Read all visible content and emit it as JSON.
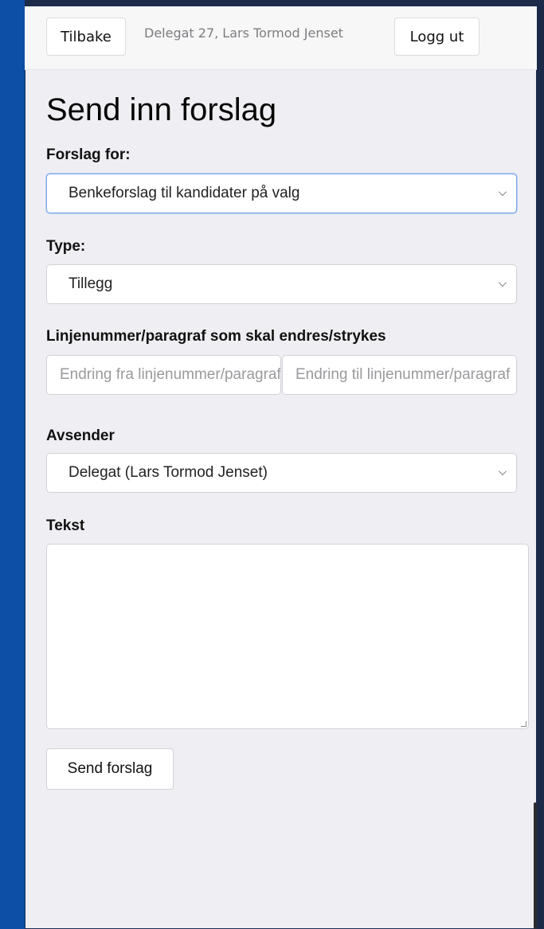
{
  "navbar": {
    "back_label": "Tilbake",
    "user_label": "Delegat 27, Lars Tormod Jenset",
    "logout_label": "Logg ut"
  },
  "page": {
    "title": "Send inn forslag"
  },
  "form": {
    "proposal_for": {
      "label": "Forslag for:",
      "selected": "Benkeforslag til kandidater på valg"
    },
    "type": {
      "label": "Type:",
      "selected": "Tillegg"
    },
    "line_numbers": {
      "label": "Linjenummer/paragraf som skal endres/strykes",
      "from_placeholder": "Endring fra linjenummer/paragraf",
      "to_placeholder": "Endring til linjenummer/paragraf"
    },
    "sender": {
      "label": "Avsender",
      "selected": "Delegat (Lars Tormod Jenset)"
    },
    "text": {
      "label": "Tekst",
      "value": ""
    },
    "submit_label": "Send forslag"
  },
  "colors": {
    "background": "#0b4a9c",
    "panel": "#efeff3",
    "focus_border": "#7aa6e6"
  }
}
